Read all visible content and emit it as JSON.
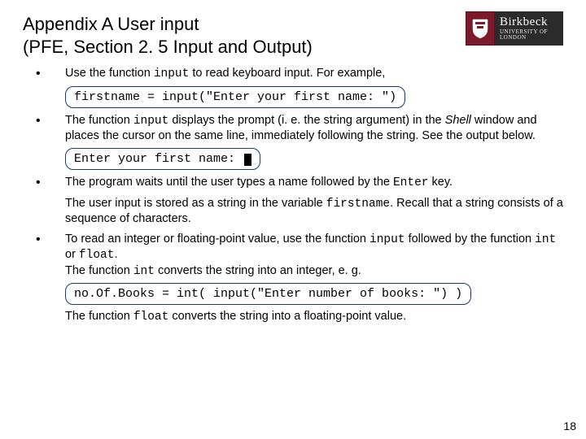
{
  "title_line1": "Appendix A User input",
  "title_line2": "(PFE, Section 2. 5 Input and Output)",
  "logo": {
    "name": "Birkbeck",
    "sub": "UNIVERSITY OF LONDON"
  },
  "b1_pre": "Use the function ",
  "b1_code": "input",
  "b1_post": " to read keyboard input. For example,",
  "code1": "firstname = input(\"Enter your first name: \")",
  "b2_a": "The function ",
  "b2_code": "input",
  "b2_b": " displays the prompt (i. e. the string argument) in the ",
  "b2_shell": "Shell",
  "b2_c": "  window and places the cursor on the same line, immediately following the string. See the output below.",
  "code2": "Enter your first name: ",
  "b3_a": "The program waits until the user types a name followed by the ",
  "b3_enter": "Enter",
  "b3_b": " key.",
  "b4_a": "The user input is stored as a string in the variable ",
  "b4_var": "firstname",
  "b4_b": ". Recall that a string consists of a sequence of characters.",
  "b5_a": "To read an integer or floating-point value, use the function ",
  "b5_input": "input",
  "b5_b": " followed by the function ",
  "b5_int": "int",
  "b5_c": " or ",
  "b5_float": "float",
  "b5_d": ".",
  "b5_e": "The function ",
  "b5_int2": "int",
  "b5_f": "  converts the string into an integer, e. g.",
  "code3": "no.Of.Books = int( input(\"Enter number of books: \") )",
  "b5_g": "The function ",
  "b5_float2": "float",
  "b5_h": "  converts the string into a floating-point value.",
  "pagenum": "18"
}
